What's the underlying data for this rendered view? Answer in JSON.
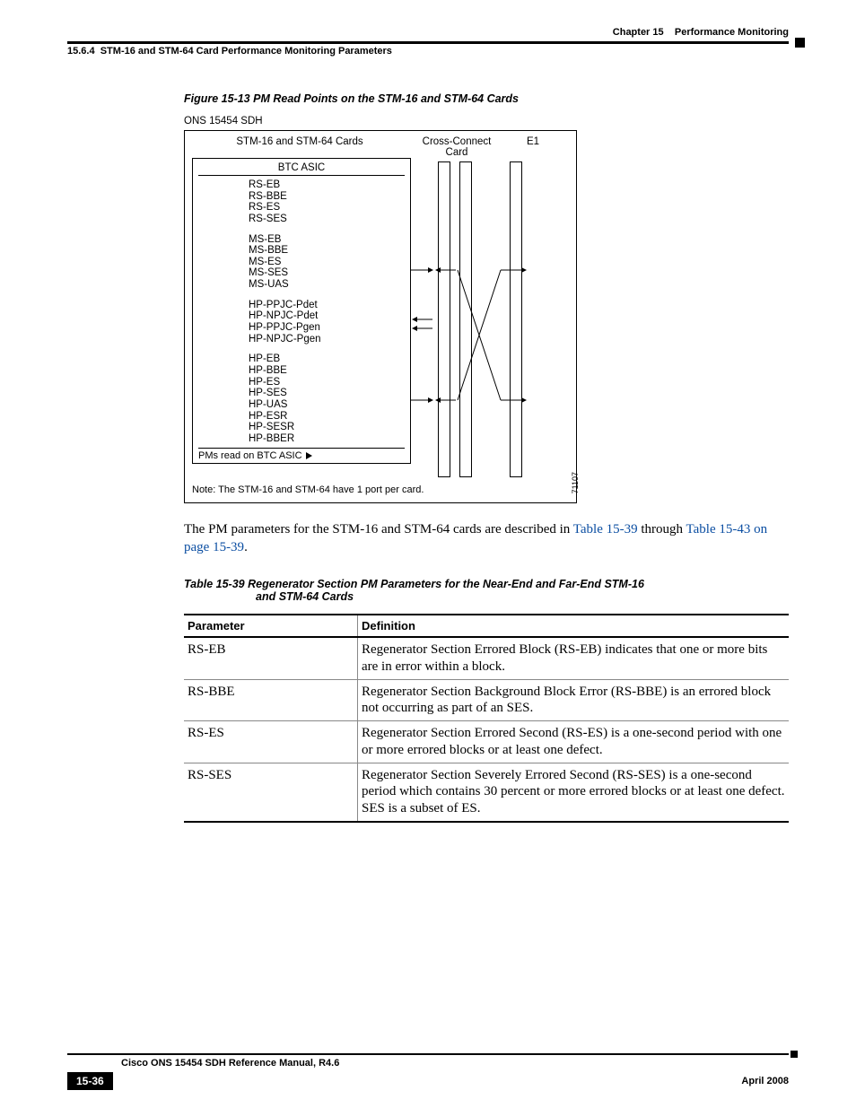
{
  "header": {
    "chapter": "Chapter 15",
    "chapter_title": "Performance Monitoring",
    "section_num": "15.6.4",
    "section_title": "STM-16 and STM-64 Card Performance Monitoring Parameters"
  },
  "figure": {
    "label": "Figure 15-13",
    "title": "PM Read Points on the STM-16 and STM-64 Cards",
    "top_title": "ONS 15454 SDH",
    "card_label": "STM-16 and STM-64 Cards",
    "cc_label": "Cross-Connect Card",
    "e1_label": "E1",
    "asic_title": "BTC ASIC",
    "groups": [
      [
        "RS-EB",
        "RS-BBE",
        "RS-ES",
        "RS-SES"
      ],
      [
        "MS-EB",
        "MS-BBE",
        "MS-ES",
        "MS-SES",
        "MS-UAS"
      ],
      [
        "HP-PPJC-Pdet",
        "HP-NPJC-Pdet",
        "HP-PPJC-Pgen",
        "HP-NPJC-Pgen"
      ],
      [
        "HP-EB",
        "HP-BBE",
        "HP-ES",
        "HP-SES",
        "HP-UAS",
        "HP-ESR",
        "HP-SESR",
        "HP-BBER"
      ]
    ],
    "pm_read": "PMs read on BTC ASIC",
    "note": "Note: The STM-16 and STM-64 have 1 port per card.",
    "side_id": "71107"
  },
  "paragraph": {
    "pre": "The PM parameters for the STM-16 and STM-64 cards are described in ",
    "link1": "Table 15-39",
    "mid": " through ",
    "link2": "Table 15-43 on page 15-39",
    "post": "."
  },
  "table": {
    "label": "Table 15-39",
    "title_line1": "Regenerator Section PM Parameters for the Near-End and Far-End STM-16",
    "title_line2": "and STM-64 Cards",
    "head_param": "Parameter",
    "head_def": "Definition",
    "rows": [
      {
        "p": "RS-EB",
        "d": "Regenerator Section Errored Block (RS-EB) indicates that one or more bits are in error within a block."
      },
      {
        "p": "RS-BBE",
        "d": "Regenerator Section Background Block Error (RS-BBE) is an errored block not occurring as part of an SES."
      },
      {
        "p": "RS-ES",
        "d": "Regenerator Section Errored Second (RS-ES) is a one-second period with one or more errored blocks or at least one defect."
      },
      {
        "p": "RS-SES",
        "d": "Regenerator Section Severely Errored Second (RS-SES) is a one-second period which contains 30 percent or more errored blocks or at least one defect. SES is a subset of ES."
      }
    ]
  },
  "footer": {
    "doc_title": "Cisco ONS 15454 SDH Reference Manual, R4.6",
    "page": "15-36",
    "date": "April 2008"
  }
}
